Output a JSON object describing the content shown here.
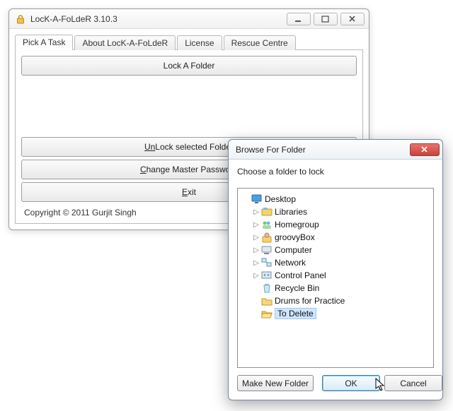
{
  "app": {
    "title": "LocK-A-FoLdeR 3.10.3",
    "tabs": [
      {
        "label": "Pick A Task",
        "active": true
      },
      {
        "label": "About LocK-A-FoLdeR",
        "active": false
      },
      {
        "label": "License",
        "active": false
      },
      {
        "label": "Rescue Centre",
        "active": false
      }
    ],
    "buttons": {
      "lock": "Lock A Folder",
      "unlock_pre": "Un",
      "unlock_post": "Lock selected Folder",
      "changepw_pre": "C",
      "changepw_post": "hange Master Password",
      "exit_pre": "E",
      "exit_post": "xit"
    },
    "copyright": "Copyright © 2011 Gurjit Singh"
  },
  "dialog": {
    "title": "Browse For Folder",
    "instruction": "Choose a folder to lock",
    "tree": [
      {
        "label": "Desktop",
        "icon": "desktop",
        "depth": 0,
        "twisty": "none"
      },
      {
        "label": "Libraries",
        "icon": "libraries",
        "depth": 1,
        "twisty": "closed"
      },
      {
        "label": "Homegroup",
        "icon": "homegroup",
        "depth": 1,
        "twisty": "closed"
      },
      {
        "label": "groovyBox",
        "icon": "user",
        "depth": 1,
        "twisty": "closed"
      },
      {
        "label": "Computer",
        "icon": "computer",
        "depth": 1,
        "twisty": "closed"
      },
      {
        "label": "Network",
        "icon": "network",
        "depth": 1,
        "twisty": "closed"
      },
      {
        "label": "Control Panel",
        "icon": "controlpanel",
        "depth": 1,
        "twisty": "closed"
      },
      {
        "label": "Recycle Bin",
        "icon": "recycle",
        "depth": 1,
        "twisty": "none"
      },
      {
        "label": "Drums for Practice",
        "icon": "folder",
        "depth": 1,
        "twisty": "none"
      },
      {
        "label": "To Delete",
        "icon": "folder-open",
        "depth": 1,
        "twisty": "none",
        "selected": true
      }
    ],
    "buttons": {
      "make_new": "Make New Folder",
      "ok": "OK",
      "cancel": "Cancel"
    }
  }
}
